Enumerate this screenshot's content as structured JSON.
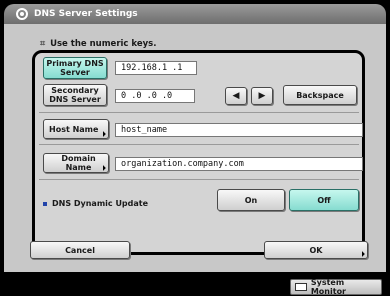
{
  "window": {
    "title": "DNS Server Settings",
    "title_icon": "gear-icon"
  },
  "hint": {
    "icon": "keypad-icon",
    "text": "Use the numeric keys."
  },
  "primary_dns": {
    "label": "Primary DNS Server",
    "value": "192.168.1  .1"
  },
  "secondary_dns": {
    "label": "Secondary DNS Server",
    "value": "0  .0  .0  .0"
  },
  "nav": {
    "left_arrow": "◀",
    "right_arrow": "▶",
    "backspace_label": "Backspace"
  },
  "host_name": {
    "label": "Host Name",
    "value": "host_name"
  },
  "domain_name": {
    "label": "Domain Name",
    "value": "organization.company.com"
  },
  "dns_dynamic_update": {
    "label": "DNS Dynamic Update",
    "on_label": "On",
    "off_label": "Off",
    "selected": "Off"
  },
  "footer": {
    "cancel_label": "Cancel",
    "ok_label": "OK"
  },
  "status": {
    "system_monitor_label": "System Monitor"
  },
  "colors": {
    "selected_key": "#86dcd0",
    "title_bar": "#7e7e7e",
    "panel": "#c8c8c8"
  }
}
